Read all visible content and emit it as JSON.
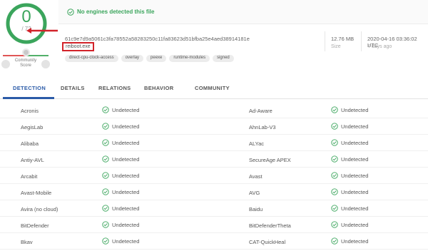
{
  "summary": {
    "score": "0",
    "total": "/ 72",
    "community_label": "Community Score",
    "banner_text": "No engines detected this file"
  },
  "file": {
    "hash": "61c9e7d9a5061c3fa78552a58283250c11fa83623d51bfba25e4aed38914181e",
    "name": "reiboot.exe",
    "tags": [
      "direct-cpu-clock-access",
      "overlay",
      "peexe",
      "runtime-modules",
      "signed"
    ],
    "size_value": "12.76 MB",
    "size_label": "Size",
    "date_value": "2020-04-16 03:36:02 UTC",
    "date_ago": "4 days ago"
  },
  "tabs": [
    {
      "label": "DETECTION",
      "active": true
    },
    {
      "label": "DETAILS",
      "active": false
    },
    {
      "label": "RELATIONS",
      "active": false
    },
    {
      "label": "BEHAVIOR",
      "active": false
    },
    {
      "label": "COMMUNITY",
      "active": false
    }
  ],
  "rows": [
    {
      "left_engine": "Acronis",
      "left_result": "Undetected",
      "right_engine": "Ad-Aware",
      "right_result": "Undetected"
    },
    {
      "left_engine": "AegisLab",
      "left_result": "Undetected",
      "right_engine": "AhnLab-V3",
      "right_result": "Undetected"
    },
    {
      "left_engine": "Alibaba",
      "left_result": "Undetected",
      "right_engine": "ALYac",
      "right_result": "Undetected"
    },
    {
      "left_engine": "Antiy-AVL",
      "left_result": "Undetected",
      "right_engine": "SecureAge APEX",
      "right_result": "Undetected"
    },
    {
      "left_engine": "Arcabit",
      "left_result": "Undetected",
      "right_engine": "Avast",
      "right_result": "Undetected"
    },
    {
      "left_engine": "Avast-Mobile",
      "left_result": "Undetected",
      "right_engine": "AVG",
      "right_result": "Undetected"
    },
    {
      "left_engine": "Avira (no cloud)",
      "left_result": "Undetected",
      "right_engine": "Baidu",
      "right_result": "Undetected"
    },
    {
      "left_engine": "BitDefender",
      "left_result": "Undetected",
      "right_engine": "BitDefenderTheta",
      "right_result": "Undetected"
    },
    {
      "left_engine": "Bkav",
      "left_result": "Undetected",
      "right_engine": "CAT-QuickHeal",
      "right_result": "Undetected"
    }
  ],
  "colors": {
    "clean_green": "#3ba55c",
    "active_tab_blue": "#2b5ba8",
    "annotation_red": "#d2232a"
  },
  "icons": {
    "undetected": "check-circle-icon",
    "banner": "check-circle-icon"
  }
}
